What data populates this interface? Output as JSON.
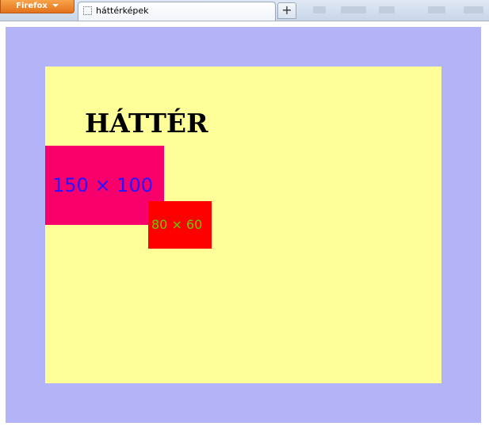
{
  "browser": {
    "menu_button_label": "Firefox",
    "tab_title": "háttérképek",
    "new_tab_label": "+"
  },
  "page": {
    "heading": "HÁTTÉR",
    "box_large_label": "150 × 100",
    "box_small_label": "80 × 60"
  },
  "colors": {
    "viewport_background": "#b3b3f8",
    "content_background": "#ffff99",
    "box_large_background": "#f7006c",
    "box_large_text": "#2a12ff",
    "box_small_background": "#ff0000",
    "box_small_text": "#66cc00"
  },
  "icons": {
    "tab_favicon": "blank-page-icon",
    "menu_arrow": "chevron-down-icon"
  }
}
